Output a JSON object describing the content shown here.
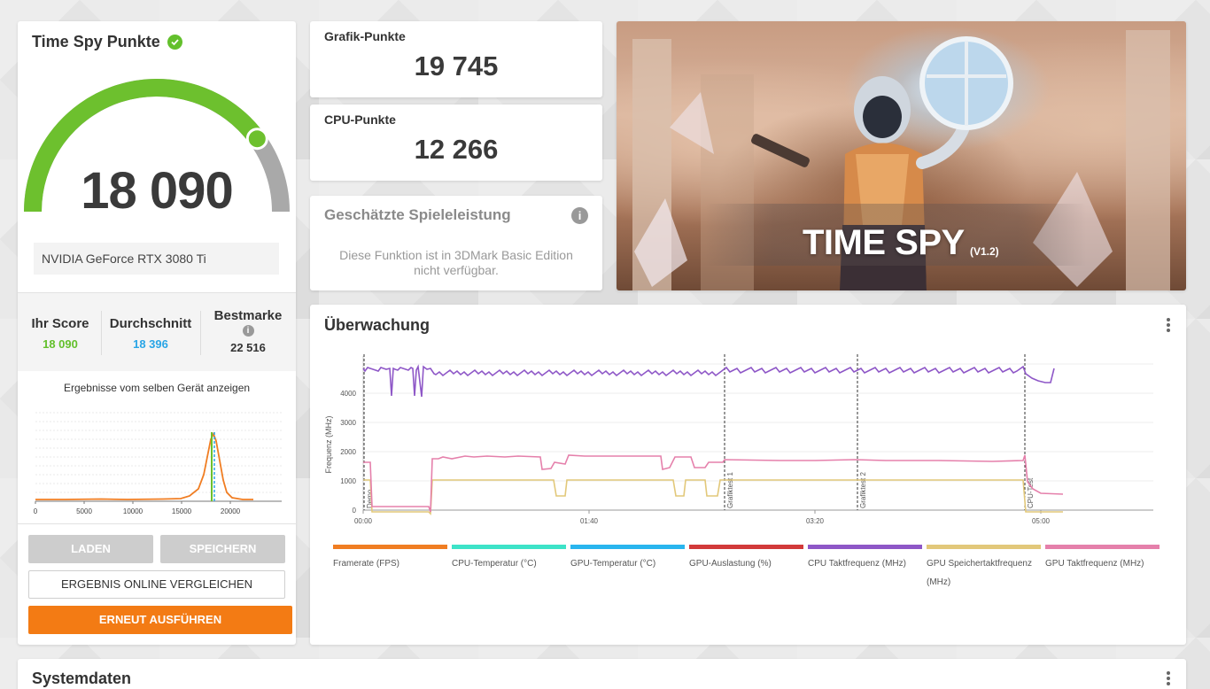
{
  "score_card": {
    "title": "Time Spy Punkte",
    "score": "18 090",
    "gpu_name": "NVIDIA GeForce RTX 3080 Ti",
    "gauge_fraction": 0.8,
    "stats": {
      "yours_label": "Ihr Score",
      "yours_value": "18 090",
      "average_label": "Durchschnitt",
      "average_value": "18 396",
      "best_label": "Bestmarke",
      "best_value": "22 516"
    },
    "distribution_title": "Ergebnisse vom selben Gerät anzeigen",
    "distribution_ticks": [
      "0",
      "5000",
      "10000",
      "15000",
      "20000"
    ],
    "buttons": {
      "load": "LADEN",
      "save": "SPEICHERN",
      "compare": "ERGEBNIS ONLINE VERGLEICHEN",
      "rerun": "ERNEUT AUSFÜHREN"
    }
  },
  "graphics_score": {
    "label": "Grafik-Punkte",
    "value": "19 745"
  },
  "cpu_score": {
    "label": "CPU-Punkte",
    "value": "12 266"
  },
  "gaming": {
    "title": "Geschätzte Spieleleistung",
    "message": "Diese Funktion ist in 3DMark Basic Edition nicht verfügbar."
  },
  "hero": {
    "title": "TIME SPY",
    "version": "(V1.2)"
  },
  "monitoring": {
    "title": "Überwachung",
    "y_axis_label": "Frequenz (MHz)",
    "y_ticks": [
      "0",
      "1000",
      "2000",
      "3000",
      "4000"
    ],
    "x_ticks": [
      "00:00",
      "01:40",
      "03:20",
      "05:00"
    ],
    "markers": [
      "Demo",
      "Grafiktest 1",
      "Grafiktest 2",
      "CPU-Test"
    ],
    "legend": [
      {
        "label": "Framerate (FPS)",
        "color": "#f07d22"
      },
      {
        "label": "CPU-Temperatur (°C)",
        "color": "#3de3c8"
      },
      {
        "label": "GPU-Temperatur (°C)",
        "color": "#29b5ee"
      },
      {
        "label": "GPU-Auslastung (%)",
        "color": "#d23a3a"
      },
      {
        "label": "CPU Taktfrequenz (MHz)",
        "color": "#8e57c7"
      },
      {
        "label": "GPU Speichertaktfrequenz (MHz)",
        "color": "#e2c87a"
      },
      {
        "label": "GPU Taktfrequenz (MHz)",
        "color": "#e580ab"
      }
    ]
  },
  "system_data": {
    "title": "Systemdaten"
  },
  "colors": {
    "accent_green": "#63c02c",
    "average_blue": "#29a5e6",
    "orange": "#f37b14"
  }
}
